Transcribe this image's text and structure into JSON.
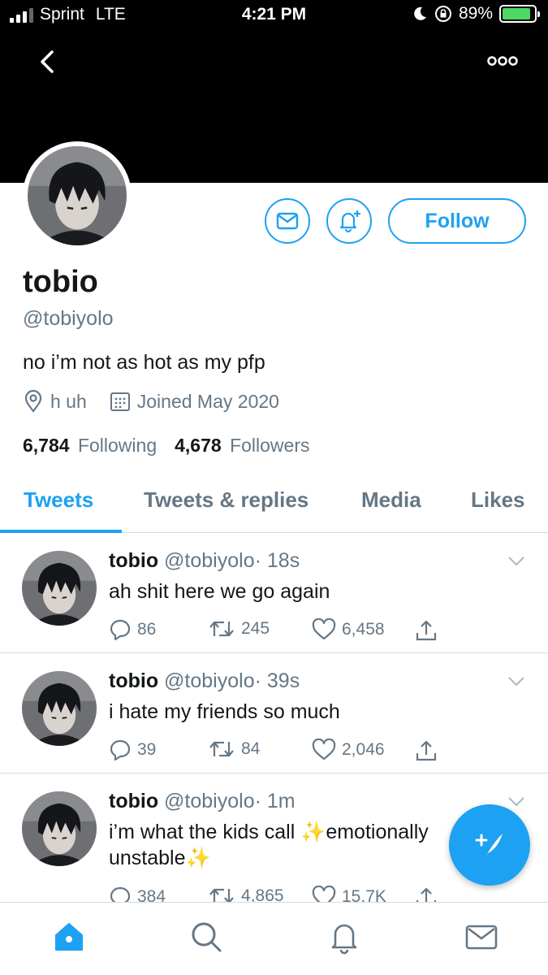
{
  "status_bar": {
    "carrier": "Sprint",
    "network": "LTE",
    "time": "4:21 PM",
    "battery": "89%",
    "battery_level": 0.89
  },
  "profile": {
    "name": "tobio",
    "handle": "@tobiyolo",
    "bio": "no i’m not as hot as my pfp",
    "location": "h uh",
    "joined": "Joined May 2020",
    "following_count": "6,784",
    "following_label": "Following",
    "followers_count": "4,678",
    "followers_label": "Followers",
    "follow_label": "Follow"
  },
  "tabs": [
    {
      "label": "Tweets",
      "active": true
    },
    {
      "label": "Tweets & replies",
      "active": false
    },
    {
      "label": "Media",
      "active": false
    },
    {
      "label": "Likes",
      "active": false
    }
  ],
  "tweets": [
    {
      "name": "tobio",
      "handle": "@tobiyolo",
      "time": "· 18s",
      "text": "ah shit here we go again",
      "replies": "86",
      "retweets": "245",
      "likes": "6,458"
    },
    {
      "name": "tobio",
      "handle": "@tobiyolo",
      "time": "· 39s",
      "text": "i hate my friends so much",
      "replies": "39",
      "retweets": "84",
      "likes": "2,046"
    },
    {
      "name": "tobio",
      "handle": "@tobiyolo",
      "time": "· 1m",
      "text": "i’m what the kids call ✨emotionally unstable✨",
      "replies": "384",
      "retweets": "4,865",
      "likes": "15.7K"
    }
  ],
  "colors": {
    "accent": "#1da1f2",
    "secondary_text": "#657786",
    "header": "#000000"
  },
  "icons": {
    "back": "chevron-left-icon",
    "more": "more-icon",
    "message": "envelope-icon",
    "notify": "bell-plus-icon",
    "location": "location-pin-icon",
    "calendar": "calendar-icon",
    "reply": "reply-icon",
    "retweet": "retweet-icon",
    "like": "heart-icon",
    "share": "share-icon",
    "compose": "compose-icon",
    "home": "home-icon",
    "search": "search-icon",
    "notifications": "bell-icon",
    "messages": "envelope-icon"
  }
}
